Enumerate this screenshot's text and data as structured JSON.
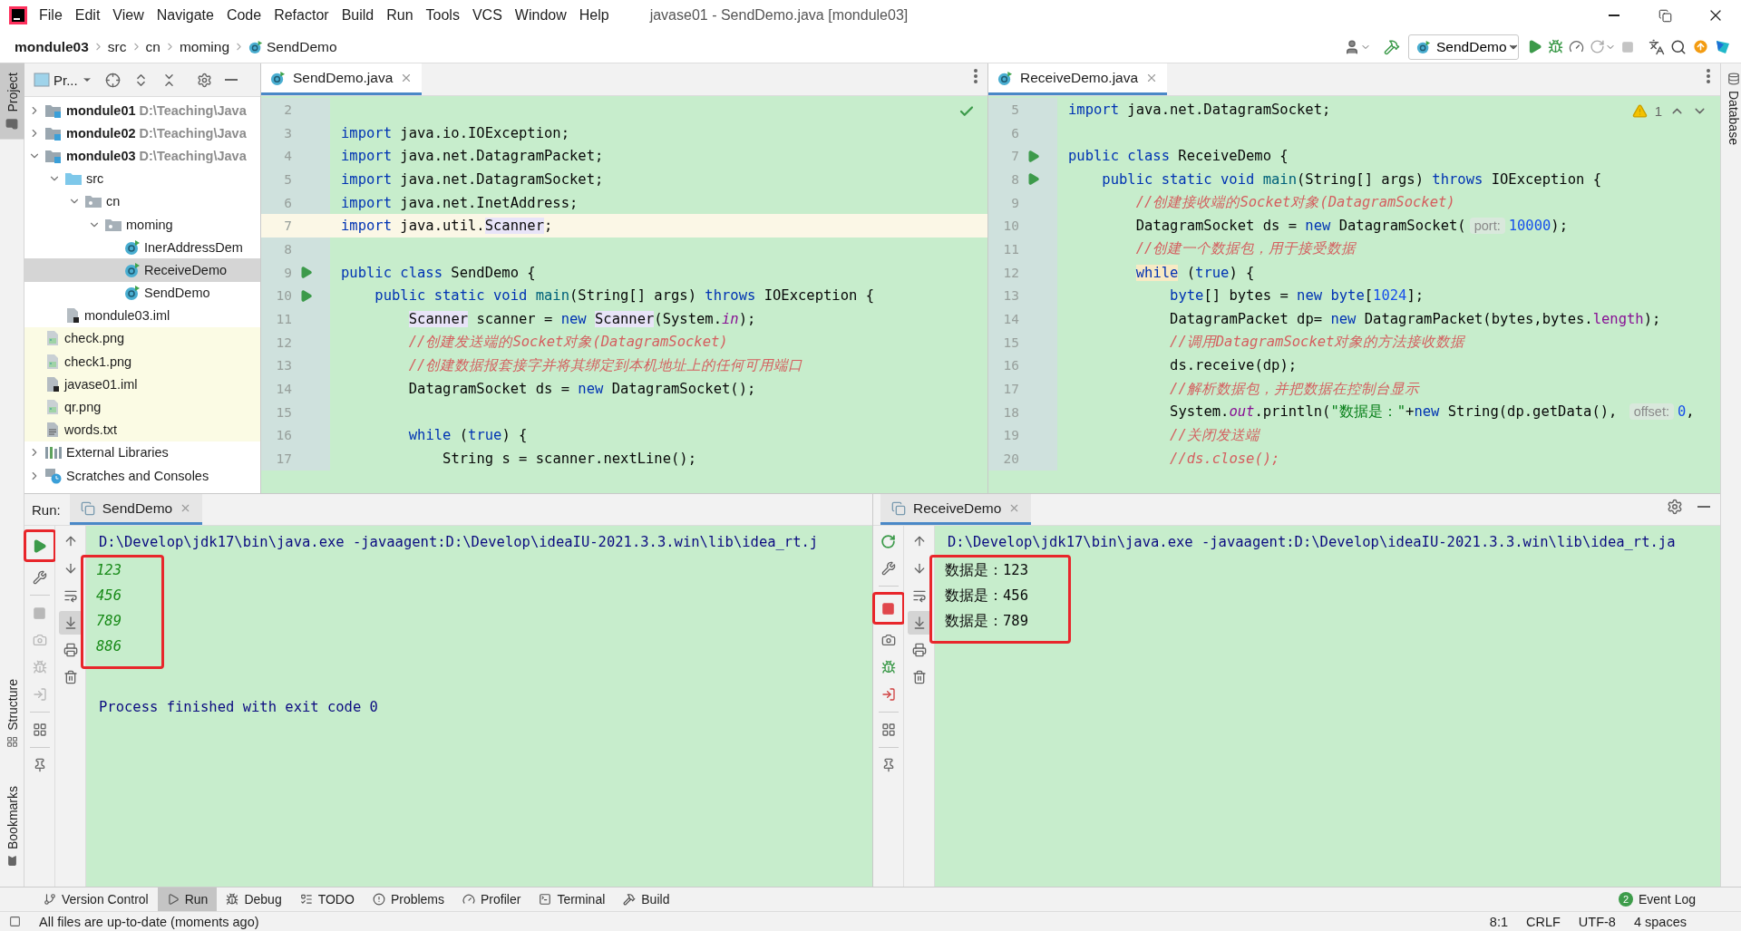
{
  "window": {
    "title": "javase01 - SendDemo.java [mondule03]",
    "menu": [
      "File",
      "Edit",
      "View",
      "Navigate",
      "Code",
      "Refactor",
      "Build",
      "Run",
      "Tools",
      "VCS",
      "Window",
      "Help"
    ]
  },
  "breadcrumbs": [
    {
      "kind": "module",
      "label": "mondule03"
    },
    {
      "kind": "folder",
      "label": "src"
    },
    {
      "kind": "folder",
      "label": "cn"
    },
    {
      "kind": "folder",
      "label": "moming"
    },
    {
      "kind": "class",
      "label": "SendDemo"
    }
  ],
  "toolbar": {
    "run_config": "SendDemo"
  },
  "left_stripe": [
    {
      "label": "Project",
      "selected": true,
      "kind": "top"
    },
    {
      "label": "Structure",
      "selected": false,
      "kind": "bottom"
    },
    {
      "label": "Bookmarks",
      "selected": false,
      "kind": "bottom"
    }
  ],
  "right_stripe": [
    {
      "label": "Database"
    }
  ],
  "project": {
    "title": "Pr...",
    "tree": [
      {
        "kind": "module",
        "name": "mondule01",
        "path": "D:\\Teaching\\Java",
        "expanded": false,
        "selected": false,
        "excluded": false
      },
      {
        "kind": "module",
        "name": "mondule02",
        "path": "D:\\Teaching\\Java",
        "expanded": false,
        "selected": false,
        "excluded": false
      },
      {
        "kind": "module",
        "name": "mondule03",
        "path": "D:\\Teaching\\Java",
        "expanded": true,
        "selected": false,
        "excluded": false,
        "children": [
          {
            "kind": "source",
            "name": "src",
            "expanded": true,
            "selected": false,
            "excluded": false,
            "children": [
              {
                "kind": "package",
                "name": "cn",
                "expanded": true,
                "selected": false,
                "excluded": false,
                "children": [
                  {
                    "kind": "package",
                    "name": "moming",
                    "expanded": true,
                    "selected": false,
                    "excluded": false,
                    "children": [
                      {
                        "kind": "class",
                        "name": "InerAddressDem",
                        "selected": false,
                        "excluded": false
                      },
                      {
                        "kind": "class",
                        "name": "ReceiveDemo",
                        "selected": true,
                        "excluded": false
                      },
                      {
                        "kind": "class",
                        "name": "SendDemo",
                        "selected": false,
                        "excluded": false
                      }
                    ]
                  }
                ]
              }
            ]
          },
          {
            "kind": "iml",
            "name": "mondule03.iml",
            "selected": false,
            "excluded": false
          }
        ]
      },
      {
        "kind": "image",
        "name": "check.png",
        "selected": false,
        "excluded": true
      },
      {
        "kind": "image",
        "name": "check1.png",
        "selected": false,
        "excluded": true
      },
      {
        "kind": "iml",
        "name": "javase01.iml",
        "selected": false,
        "excluded": true
      },
      {
        "kind": "image",
        "name": "qr.png",
        "selected": false,
        "excluded": true
      },
      {
        "kind": "text",
        "name": "words.txt",
        "selected": false,
        "excluded": true
      },
      {
        "kind": "libraries",
        "name": "External Libraries",
        "expanded": false,
        "selected": false,
        "excluded": false
      },
      {
        "kind": "scratches",
        "name": "Scratches and Consoles",
        "expanded": false,
        "selected": false,
        "excluded": false
      }
    ]
  },
  "editors": [
    {
      "tab": "SendDemo.java",
      "inspection": {
        "kind": "ok"
      },
      "lines": [
        {
          "number": "2",
          "runnable": false
        },
        {
          "number": "3",
          "runnable": false,
          "tokens": [
            {
              "kind": "kw",
              "text": "import"
            },
            {
              "kind": "id",
              "text": " java.io.IOException;"
            }
          ]
        },
        {
          "number": "4",
          "runnable": false,
          "tokens": [
            {
              "kind": "kw",
              "text": "import"
            },
            {
              "kind": "id",
              "text": " java.net.DatagramPacket;"
            }
          ]
        },
        {
          "number": "5",
          "runnable": false,
          "tokens": [
            {
              "kind": "kw",
              "text": "import"
            },
            {
              "kind": "id",
              "text": " java.net.DatagramSocket;"
            }
          ]
        },
        {
          "number": "6",
          "runnable": false,
          "tokens": [
            {
              "kind": "kw",
              "text": "import"
            },
            {
              "kind": "id",
              "text": " java.net.InetAddress;"
            }
          ]
        },
        {
          "number": "7",
          "runnable": false,
          "current": true,
          "tokens": [
            {
              "kind": "kw",
              "text": "import"
            },
            {
              "kind": "id",
              "text": " java.util."
            },
            {
              "kind": "hl",
              "text": "Scanner"
            },
            {
              "kind": "id",
              "text": ";"
            }
          ]
        },
        {
          "number": "8",
          "runnable": false
        },
        {
          "number": "9",
          "runnable": true,
          "tokens": [
            {
              "kind": "kw",
              "text": "public class"
            },
            {
              "kind": "id",
              "text": " SendDemo {"
            }
          ],
          "children": [
            {
              "number": "10",
              "runnable": true,
              "tokens": [
                {
                  "kind": "kw",
                  "text": "public static void"
                },
                {
                  "kind": "fn",
                  "text": " main"
                },
                {
                  "kind": "id",
                  "text": "(String[] args) "
                },
                {
                  "kind": "kw",
                  "text": "throws"
                },
                {
                  "kind": "id",
                  "text": " IOException {"
                }
              ],
              "children": [
                {
                  "number": "11",
                  "runnable": false,
                  "tokens": [
                    {
                      "kind": "hl",
                      "text": "Scanner"
                    },
                    {
                      "kind": "id",
                      "text": " scanner = "
                    },
                    {
                      "kind": "kw",
                      "text": "new "
                    },
                    {
                      "kind": "hl",
                      "text": "Scanner"
                    },
                    {
                      "kind": "id",
                      "text": "(System."
                    },
                    {
                      "kind": "st",
                      "text": "in"
                    },
                    {
                      "kind": "id",
                      "text": ");"
                    }
                  ]
                },
                {
                  "number": "12",
                  "runnable": false,
                  "tokens": [
                    {
                      "kind": "cm",
                      "text": "//创建发送端的Socket对象(DatagramSocket)"
                    }
                  ]
                },
                {
                  "number": "13",
                  "runnable": false,
                  "tokens": [
                    {
                      "kind": "cm",
                      "text": "//创建数据报套接字并将其绑定到本机地址上的任何可用端口"
                    }
                  ]
                },
                {
                  "number": "14",
                  "runnable": false,
                  "tokens": [
                    {
                      "kind": "id",
                      "text": "DatagramSocket ds = "
                    },
                    {
                      "kind": "kw",
                      "text": "new"
                    },
                    {
                      "kind": "id",
                      "text": " DatagramSocket();"
                    }
                  ]
                },
                {
                  "number": "15",
                  "runnable": false
                },
                {
                  "number": "16",
                  "runnable": false,
                  "tokens": [
                    {
                      "kind": "kw",
                      "text": "while"
                    },
                    {
                      "kind": "id",
                      "text": " ("
                    },
                    {
                      "kind": "kw",
                      "text": "true"
                    },
                    {
                      "kind": "id",
                      "text": ") {"
                    }
                  ],
                  "children": [
                    {
                      "number": "17",
                      "runnable": false,
                      "tokens": [
                        {
                          "kind": "id",
                          "text": "String s = scanner.nextLine();"
                        }
                      ]
                    }
                  ]
                }
              ]
            }
          ]
        }
      ]
    },
    {
      "tab": "ReceiveDemo.java",
      "inspection": {
        "kind": "warning",
        "count": "1"
      },
      "lines": [
        {
          "number": "5",
          "runnable": false,
          "tokens": [
            {
              "kind": "kw",
              "text": "import"
            },
            {
              "kind": "id",
              "text": " java.net.DatagramSocket;"
            }
          ]
        },
        {
          "number": "6",
          "runnable": false
        },
        {
          "number": "7",
          "runnable": true,
          "tokens": [
            {
              "kind": "kw",
              "text": "public class"
            },
            {
              "kind": "id",
              "text": " ReceiveDemo {"
            }
          ],
          "children": [
            {
              "number": "8",
              "runnable": true,
              "tokens": [
                {
                  "kind": "kw",
                  "text": "public static void"
                },
                {
                  "kind": "fn",
                  "text": " main"
                },
                {
                  "kind": "id",
                  "text": "(String[] args) "
                },
                {
                  "kind": "kw",
                  "text": "throws"
                },
                {
                  "kind": "id",
                  "text": " IOException {"
                }
              ],
              "children": [
                {
                  "number": "9",
                  "runnable": false,
                  "tokens": [
                    {
                      "kind": "cm",
                      "text": "//创建接收端的Socket对象(DatagramSocket)"
                    }
                  ]
                },
                {
                  "number": "10",
                  "runnable": false,
                  "tokens": [
                    {
                      "kind": "id",
                      "text": "DatagramSocket ds = "
                    },
                    {
                      "kind": "kw",
                      "text": "new"
                    },
                    {
                      "kind": "id",
                      "text": " DatagramSocket("
                    },
                    {
                      "kind": "hint",
                      "text": "port:"
                    },
                    {
                      "kind": "num",
                      "text": "10000"
                    },
                    {
                      "kind": "id",
                      "text": ");"
                    }
                  ]
                },
                {
                  "number": "11",
                  "runnable": false,
                  "tokens": [
                    {
                      "kind": "cm",
                      "text": "//创建一个数据包，用于接受数据"
                    }
                  ]
                },
                {
                  "number": "12",
                  "runnable": false,
                  "tokens": [
                    {
                      "kind": "kwhl",
                      "text": "while"
                    },
                    {
                      "kind": "id",
                      "text": " ("
                    },
                    {
                      "kind": "kw",
                      "text": "true"
                    },
                    {
                      "kind": "id",
                      "text": ") {"
                    }
                  ],
                  "children": [
                    {
                      "number": "13",
                      "runnable": false,
                      "tokens": [
                        {
                          "kind": "kw",
                          "text": "byte"
                        },
                        {
                          "kind": "id",
                          "text": "[] bytes = "
                        },
                        {
                          "kind": "kw",
                          "text": "new byte"
                        },
                        {
                          "kind": "id",
                          "text": "["
                        },
                        {
                          "kind": "num",
                          "text": "1024"
                        },
                        {
                          "kind": "id",
                          "text": "];"
                        }
                      ]
                    },
                    {
                      "number": "14",
                      "runnable": false,
                      "tokens": [
                        {
                          "kind": "id",
                          "text": "DatagramPacket dp= "
                        },
                        {
                          "kind": "kw",
                          "text": "new"
                        },
                        {
                          "kind": "id",
                          "text": " DatagramPacket(bytes,bytes."
                        },
                        {
                          "kind": "field",
                          "text": "length"
                        },
                        {
                          "kind": "id",
                          "text": ");"
                        }
                      ]
                    },
                    {
                      "number": "15",
                      "runnable": false,
                      "tokens": [
                        {
                          "kind": "cm",
                          "text": "//调用DatagramSocket对象的方法接收数据"
                        }
                      ]
                    },
                    {
                      "number": "16",
                      "runnable": false,
                      "tokens": [
                        {
                          "kind": "id",
                          "text": "ds.receive(dp);"
                        }
                      ]
                    },
                    {
                      "number": "17",
                      "runnable": false,
                      "tokens": [
                        {
                          "kind": "cm",
                          "text": "//解析数据包，并把数据在控制台显示"
                        }
                      ]
                    },
                    {
                      "number": "18",
                      "runnable": false,
                      "tokens": [
                        {
                          "kind": "id",
                          "text": "System."
                        },
                        {
                          "kind": "st",
                          "text": "out"
                        },
                        {
                          "kind": "id",
                          "text": ".println("
                        },
                        {
                          "kind": "str",
                          "text": "\"数据是：\""
                        },
                        {
                          "kind": "id",
                          "text": "+"
                        },
                        {
                          "kind": "kw",
                          "text": "new"
                        },
                        {
                          "kind": "id",
                          "text": " String(dp.getData(), "
                        },
                        {
                          "kind": "hint",
                          "text": "offset:"
                        },
                        {
                          "kind": "num",
                          "text": "0"
                        },
                        {
                          "kind": "id",
                          "text": ","
                        }
                      ]
                    },
                    {
                      "number": "19",
                      "runnable": false,
                      "tokens": [
                        {
                          "kind": "cm",
                          "text": "//关闭发送端"
                        }
                      ]
                    },
                    {
                      "number": "20",
                      "runnable": false,
                      "tokens": [
                        {
                          "kind": "cm",
                          "text": "//ds.close();"
                        }
                      ]
                    }
                  ]
                }
              ]
            }
          ]
        }
      ]
    }
  ],
  "run_panels": [
    {
      "header": "Run:",
      "tab": "SendDemo",
      "running": false,
      "rerun_highlighted": true,
      "stop_highlighted": false,
      "console": [
        {
          "kind": "command",
          "text": "D:\\Develop\\jdk17\\bin\\java.exe -javaagent:D:\\Develop\\ideaIU-2021.3.3.win\\lib\\idea_rt.j"
        },
        {
          "kind": "group",
          "highlighted": true,
          "lines": [
            {
              "kind": "input",
              "text": "123"
            },
            {
              "kind": "input",
              "text": "456"
            },
            {
              "kind": "input",
              "text": "789"
            },
            {
              "kind": "input",
              "text": "886"
            }
          ]
        },
        {
          "kind": "status",
          "text": "Process finished with exit code 0"
        }
      ]
    },
    {
      "tab": "ReceiveDemo",
      "running": true,
      "rerun_highlighted": false,
      "stop_highlighted": true,
      "console": [
        {
          "kind": "command",
          "text": "D:\\Develop\\jdk17\\bin\\java.exe -javaagent:D:\\Develop\\ideaIU-2021.3.3.win\\lib\\idea_rt.ja"
        },
        {
          "kind": "group",
          "highlighted": true,
          "lines": [
            {
              "kind": "output",
              "text": "数据是：123"
            },
            {
              "kind": "output",
              "text": "数据是：456"
            },
            {
              "kind": "output",
              "text": "数据是：789"
            }
          ]
        }
      ]
    }
  ],
  "tool_tabs": [
    {
      "label": "Version Control",
      "selected": false
    },
    {
      "label": "Run",
      "selected": true
    },
    {
      "label": "Debug",
      "selected": false
    },
    {
      "label": "TODO",
      "selected": false
    },
    {
      "label": "Problems",
      "selected": false
    },
    {
      "label": "Profiler",
      "selected": false
    },
    {
      "label": "Terminal",
      "selected": false
    },
    {
      "label": "Build",
      "selected": false
    }
  ],
  "event_log": {
    "label": "Event Log",
    "badge": "2"
  },
  "status_bar": {
    "message": "All files are up-to-date (moments ago)",
    "position": "8:1",
    "line_separator": "CRLF",
    "encoding": "UTF-8",
    "indent": "4 spaces"
  }
}
